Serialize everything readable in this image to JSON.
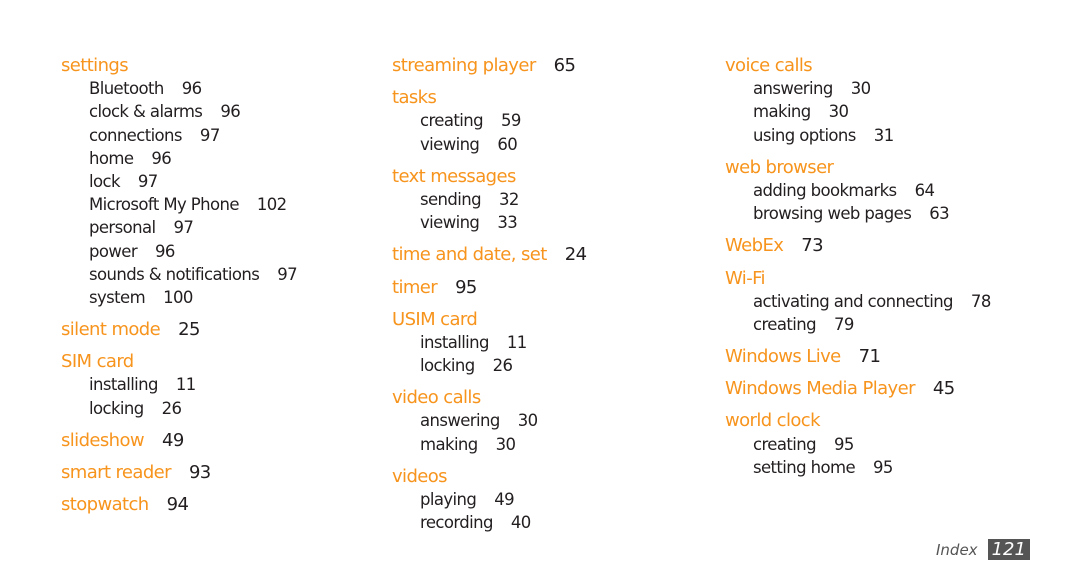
{
  "accent_color": "#f7941d",
  "columns": [
    [
      {
        "term": "settings",
        "page": "",
        "subs": [
          {
            "term": "Bluetooth",
            "page": "96"
          },
          {
            "term": "clock & alarms",
            "page": "96"
          },
          {
            "term": "connections",
            "page": "97"
          },
          {
            "term": "home",
            "page": "96"
          },
          {
            "term": "lock",
            "page": "97"
          },
          {
            "term": "Microsoft My Phone",
            "page": "102"
          },
          {
            "term": "personal",
            "page": "97"
          },
          {
            "term": "power",
            "page": "96"
          },
          {
            "term": "sounds & notifications",
            "page": "97"
          },
          {
            "term": "system",
            "page": "100"
          }
        ]
      },
      {
        "term": "silent mode",
        "page": "25",
        "subs": []
      },
      {
        "term": "SIM card",
        "page": "",
        "subs": [
          {
            "term": "installing",
            "page": "11"
          },
          {
            "term": "locking",
            "page": "26"
          }
        ]
      },
      {
        "term": "slideshow",
        "page": "49",
        "subs": []
      },
      {
        "term": "smart reader",
        "page": "93",
        "subs": []
      },
      {
        "term": "stopwatch",
        "page": "94",
        "subs": []
      }
    ],
    [
      {
        "term": "streaming player",
        "page": "65",
        "subs": []
      },
      {
        "term": "tasks",
        "page": "",
        "subs": [
          {
            "term": "creating",
            "page": "59"
          },
          {
            "term": "viewing",
            "page": "60"
          }
        ]
      },
      {
        "term": "text messages",
        "page": "",
        "subs": [
          {
            "term": "sending",
            "page": "32"
          },
          {
            "term": "viewing",
            "page": "33"
          }
        ]
      },
      {
        "term": "time and date, set",
        "page": "24",
        "subs": []
      },
      {
        "term": "timer",
        "page": "95",
        "subs": []
      },
      {
        "term": "USIM card",
        "page": "",
        "subs": [
          {
            "term": "installing",
            "page": "11"
          },
          {
            "term": "locking",
            "page": "26"
          }
        ]
      },
      {
        "term": "video calls",
        "page": "",
        "subs": [
          {
            "term": "answering",
            "page": "30"
          },
          {
            "term": "making",
            "page": "30"
          }
        ]
      },
      {
        "term": "videos",
        "page": "",
        "subs": [
          {
            "term": "playing",
            "page": "49"
          },
          {
            "term": "recording",
            "page": "40"
          }
        ]
      }
    ],
    [
      {
        "term": "voice calls",
        "page": "",
        "subs": [
          {
            "term": "answering",
            "page": "30"
          },
          {
            "term": "making",
            "page": "30"
          },
          {
            "term": "using options",
            "page": "31"
          }
        ]
      },
      {
        "term": "web browser",
        "page": "",
        "subs": [
          {
            "term": "adding bookmarks",
            "page": "64"
          },
          {
            "term": "browsing web pages",
            "page": "63"
          }
        ]
      },
      {
        "term": "WebEx",
        "page": "73",
        "subs": []
      },
      {
        "term": "Wi-Fi",
        "page": "",
        "subs": [
          {
            "term": "activating and connecting",
            "page": "78"
          },
          {
            "term": "creating",
            "page": "79"
          }
        ]
      },
      {
        "term": "Windows Live",
        "page": "71",
        "subs": []
      },
      {
        "term": "Windows Media Player",
        "page": "45",
        "subs": []
      },
      {
        "term": "world clock",
        "page": "",
        "subs": [
          {
            "term": "creating",
            "page": "95"
          },
          {
            "term": "setting home",
            "page": "95"
          }
        ]
      }
    ]
  ],
  "footer": {
    "section": "Index",
    "page_number": "121"
  }
}
